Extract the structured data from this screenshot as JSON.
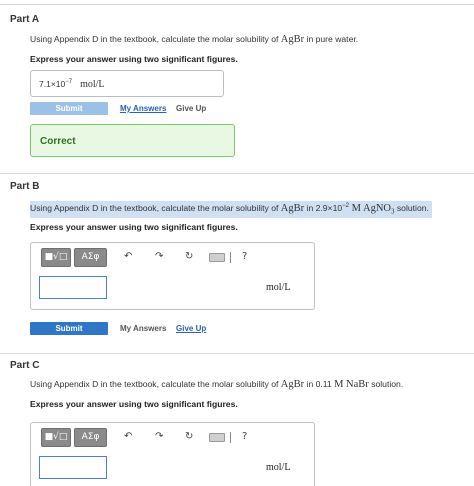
{
  "parts": {
    "a": {
      "title": "Part A",
      "question_prefix": "Using Appendix D in the textbook, calculate the molar solubility of ",
      "compound": "AgBr",
      "question_suffix": " in pure water.",
      "express": "Express your answer using two significant figures.",
      "answer_base": "7.1×10",
      "answer_exp": "−7",
      "answer_unit": "mol/L",
      "submit_label": "Submit",
      "my_answers_label": "My Answers",
      "give_up_label": "Give Up",
      "feedback": "Correct"
    },
    "b": {
      "title": "Part B",
      "question_prefix": "Using Appendix D in the textbook, calculate the molar solubility of ",
      "compound": "AgBr",
      "question_mid": " in 2.9×10",
      "question_exp": "−2",
      "question_conc": " M AgNO",
      "question_sub": "3",
      "question_suffix": " solution.",
      "express": "Express your answer using two significant figures.",
      "unit": "mol/L",
      "submit_label": "Submit",
      "my_answers_label": "My Answers",
      "give_up_label": "Give Up"
    },
    "c": {
      "title": "Part C",
      "question_prefix": "Using Appendix D in the textbook, calculate the molar solubility of ",
      "compound": "AgBr",
      "question_mid": " in 0.11 ",
      "question_conc": "M NaBr",
      "question_suffix": " solution.",
      "express": "Express your answer using two significant figures.",
      "unit": "mol/L"
    }
  },
  "toolbar": {
    "templates_glyph": "■√□",
    "greek_glyph": "ΑΣφ",
    "undo_glyph": "↶",
    "redo_glyph": "↷",
    "reset_glyph": "↻",
    "help_glyph": "?",
    "icons": [
      "templates-icon",
      "greek-letters-icon",
      "undo-icon",
      "redo-icon",
      "reset-icon",
      "keyboard-icon",
      "help-icon"
    ]
  },
  "colors": {
    "submit_blue": "#2f76c5",
    "submit_disabled": "#9cc1e7",
    "link_blue": "#2a61b0",
    "correct_bg": "#e9f8e3",
    "correct_border": "#7bc86b",
    "highlight": "#cfe0f3"
  }
}
